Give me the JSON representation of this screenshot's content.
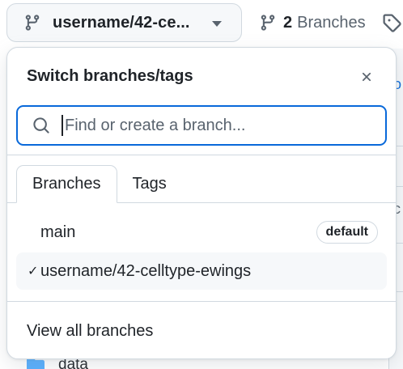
{
  "header": {
    "current_branch_label": "username/42-ce...",
    "branch_count": "2",
    "branches_word": "Branches"
  },
  "popover": {
    "title": "Switch branches/tags",
    "search": {
      "placeholder": "Find or create a branch...",
      "value": ""
    },
    "tabs": [
      {
        "label": "Branches",
        "active": true
      },
      {
        "label": "Tags",
        "active": false
      }
    ],
    "branches": [
      {
        "name": "main",
        "badge": "default",
        "selected": false
      },
      {
        "name": "username/42-celltype-ewings",
        "badge": "",
        "selected": true
      }
    ],
    "selected_mark": "✓",
    "footer_link": "View all branches"
  },
  "background": {
    "fragments": [
      "o",
      "c"
    ],
    "file_row": "data"
  },
  "colors": {
    "accent": "#0969da",
    "border": "#d1d9e0",
    "muted_text": "#59636e",
    "canvas_subtle": "#f6f8fa",
    "folder": "#54aeff"
  },
  "icons": [
    "git-branch-icon",
    "caret-down-icon",
    "tag-icon",
    "close-icon",
    "search-icon",
    "check-icon",
    "folder-icon"
  ]
}
